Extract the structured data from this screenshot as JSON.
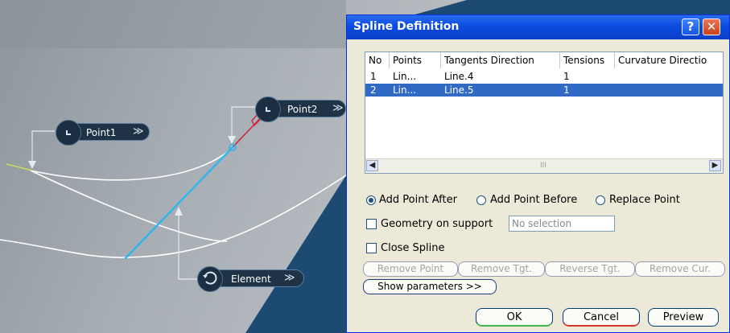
{
  "viewport": {
    "tags": {
      "point1": "Point1",
      "point2": "Point2",
      "element": "Element",
      "more": "≫"
    },
    "colors": {
      "background": "#1d4a73",
      "surface": "#9aa3ab",
      "selection": "#2db6ef",
      "constraint": "#c8283c"
    }
  },
  "dialog": {
    "title": "Spline Definition",
    "help_label": "?",
    "close_label": "✕",
    "table": {
      "columns": [
        "No",
        "Points",
        "Tangents Direction",
        "Tensions",
        "Curvature Directio"
      ],
      "rows": [
        {
          "no": "1",
          "points": "Lin...",
          "tangent": "Line.4",
          "tension": "1",
          "curvature": ""
        },
        {
          "no": "2",
          "points": "Lin...",
          "tangent": "Line.5",
          "tension": "1",
          "curvature": ""
        }
      ],
      "selected_row": 2,
      "scroll_thumb": "III"
    },
    "options": {
      "add_after": "Add Point After",
      "add_before": "Add Point Before",
      "replace": "Replace Point",
      "selected": "Add Point After"
    },
    "geometry_on_support": {
      "label": "Geometry on support",
      "placeholder": "No selection",
      "checked": false
    },
    "close_spline": {
      "label": "Close Spline",
      "checked": false
    },
    "buttons": {
      "remove_point": "Remove Point",
      "remove_tgt": "Remove Tgt.",
      "reverse_tgt": "Reverse Tgt.",
      "remove_cur": "Remove Cur.",
      "show_params": "Show parameters >>",
      "ok": "OK",
      "cancel": "Cancel",
      "preview": "Preview"
    }
  }
}
